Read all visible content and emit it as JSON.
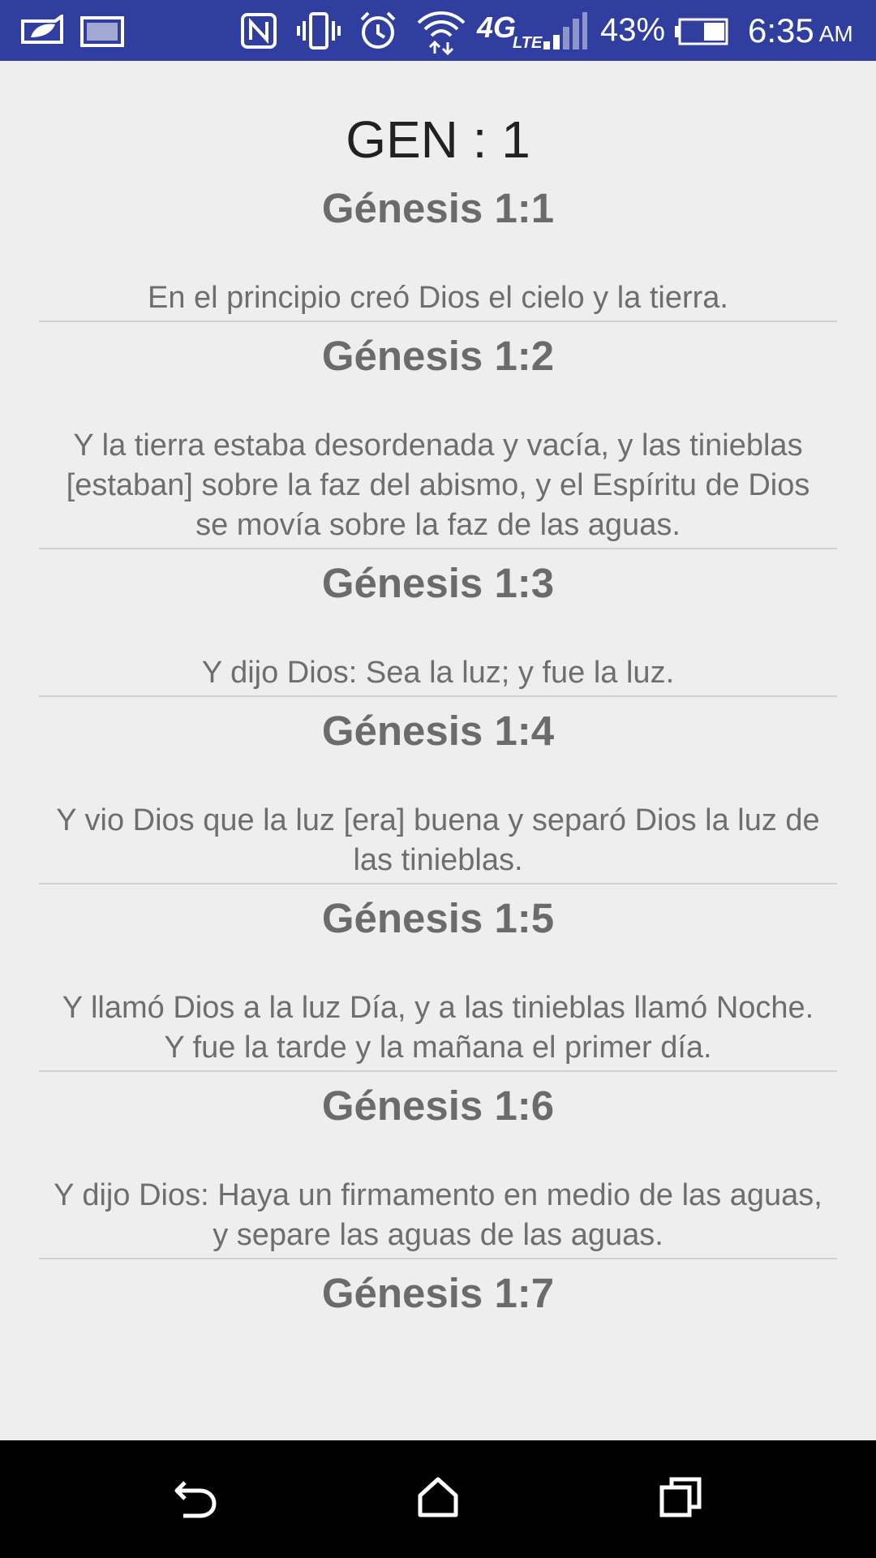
{
  "status_bar": {
    "icons": [
      "leaf-notification-icon",
      "image-notification-icon",
      "nfc-icon",
      "vibrate-icon",
      "alarm-icon",
      "wifi-icon",
      "lte-4g-icon",
      "signal-icon",
      "battery-icon"
    ],
    "network_label": "4G",
    "network_sub": "LTE",
    "battery_percent": "43%",
    "time": "6:35",
    "ampm": "AM",
    "background_color": "#303F9F"
  },
  "chapter": {
    "title": "GEN : 1"
  },
  "verses": [
    {
      "reference": "Génesis 1:1",
      "text": "En el principio creó Dios el cielo y la tierra."
    },
    {
      "reference": "Génesis 1:2",
      "text": "Y la tierra estaba desordenada y vacía, y las tinieblas [estaban] sobre la faz del abismo, y el Espíritu de Dios se movía sobre la faz de las aguas."
    },
    {
      "reference": "Génesis 1:3",
      "text": "Y dijo Dios: Sea la luz; y fue la luz."
    },
    {
      "reference": "Génesis 1:4",
      "text": "Y vio Dios que la luz [era] buena y separó Dios la luz de las tinieblas."
    },
    {
      "reference": "Génesis 1:5",
      "text": "Y llamó Dios a la luz Día, y a las tinieblas llamó Noche. Y fue la tarde y la mañana el primer día."
    },
    {
      "reference": "Génesis 1:6",
      "text": "Y dijo Dios: Haya un firmamento en medio de las aguas, y separe las aguas de las aguas."
    },
    {
      "reference": "Génesis 1:7",
      "text": ""
    }
  ],
  "nav_bar": {
    "buttons": [
      "back-icon",
      "home-icon",
      "recents-icon"
    ]
  }
}
